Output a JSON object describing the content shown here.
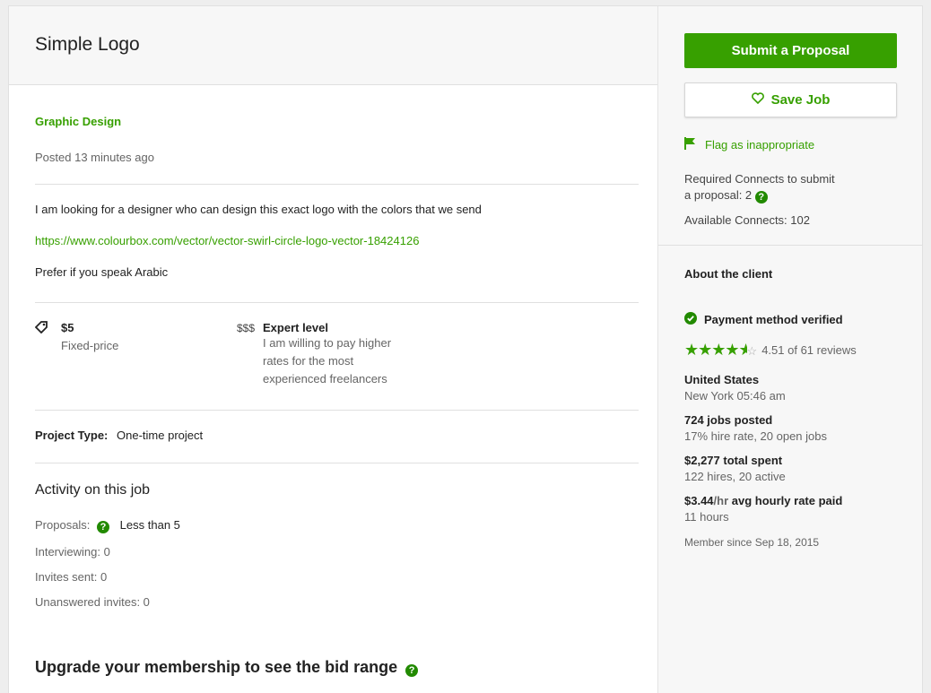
{
  "job": {
    "title": "Simple Logo",
    "category": "Graphic Design",
    "posted": "Posted 13 minutes ago",
    "description_1": "I am looking for a designer who can design this exact logo with the colors that we send",
    "link": "https://www.colourbox.com/vector/vector-swirl-circle-logo-vector-18424126",
    "description_2": "Prefer if you speak Arabic"
  },
  "details": {
    "price": "$5",
    "price_type": "Fixed-price",
    "level_icon": "$$$",
    "level": "Expert level",
    "level_desc_1": "I am willing to pay higher",
    "level_desc_2": "rates for the most",
    "level_desc_3": "experienced freelancers"
  },
  "project_type": {
    "label": "Project Type:",
    "value": "One-time project"
  },
  "activity": {
    "title": "Activity on this job",
    "proposals_label": "Proposals:",
    "proposals_value": "Less than 5",
    "interviewing": "Interviewing: 0",
    "invites_sent": "Invites sent: 0",
    "unanswered": "Unanswered invites: 0"
  },
  "upgrade": {
    "text": "Upgrade your membership to see the bid range"
  },
  "sidebar": {
    "submit_label": "Submit a Proposal",
    "save_label": "Save Job",
    "flag_label": "Flag as inappropriate",
    "connects_line1": "Required Connects to submit",
    "connects_line2": "a proposal: 2",
    "available_connects": "Available Connects: 102"
  },
  "client": {
    "heading": "About the client",
    "payment": "Payment method verified",
    "rating": 4.51,
    "rating_text": "4.51 of 61 reviews",
    "country": "United States",
    "city_time": "New York 05:46 am",
    "jobs_posted": "724 jobs posted",
    "hire_rate": "17% hire rate, 20 open jobs",
    "total_spent": "$2,277 total spent",
    "hires": "122 hires, 20 active",
    "hourly_amount": "$3.44",
    "hourly_unit": "/hr",
    "hourly_label": " avg hourly rate paid",
    "hours": "11 hours",
    "member_since": "Member since Sep 18, 2015"
  },
  "colors": {
    "accent": "#37a000",
    "badge": "#228a00"
  }
}
